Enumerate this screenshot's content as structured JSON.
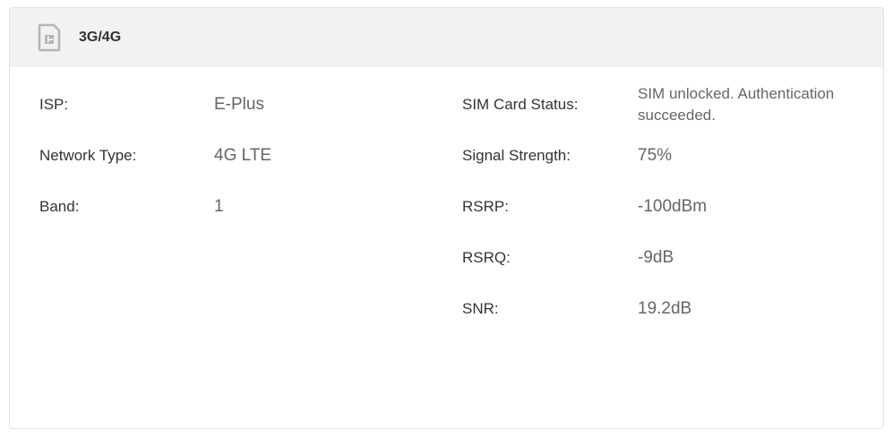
{
  "card": {
    "title": "3G/4G",
    "icon": "sim-card-icon"
  },
  "left": [
    {
      "label": "ISP:",
      "value": "E-Plus"
    },
    {
      "label": "Network Type:",
      "value": "4G LTE"
    },
    {
      "label": "Band:",
      "value": "1"
    }
  ],
  "right": [
    {
      "label": "SIM Card Status:",
      "value": "SIM unlocked. Authentication succeeded."
    },
    {
      "label": "Signal Strength:",
      "value": "75%"
    },
    {
      "label": "RSRP:",
      "value": "-100dBm"
    },
    {
      "label": "RSRQ:",
      "value": "-9dB"
    },
    {
      "label": "SNR:",
      "value": "19.2dB"
    }
  ],
  "colors": {
    "header_bg": "#f2f2f2",
    "label": "#333333",
    "value": "#666666",
    "icon": "#b5b5b5"
  }
}
